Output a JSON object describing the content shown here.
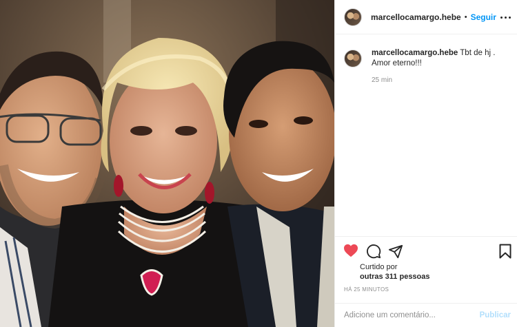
{
  "post": {
    "username": "marcellocamargo.hebe",
    "follow_label": "Seguir",
    "separator": "•",
    "caption_text": " Tbt de hj .",
    "caption_line2": "Amor eterno!!!",
    "caption_time": "25 min",
    "liked_by_label": "Curtido por",
    "liked_by_others": "outras 311 pessoas",
    "posted_ago": "HÁ 25 MINUTOS",
    "comment_placeholder": "Adicione um comentário...",
    "publish_label": "Publicar"
  },
  "icons": {
    "options": "more-icon",
    "like": "heart-icon",
    "comment": "comment-icon",
    "share": "send-icon",
    "save": "bookmark-icon"
  },
  "colors": {
    "accent": "#0095f6",
    "heart": "#ed4956",
    "publish_disabled": "#b2dffc",
    "muted": "#8e8e8e"
  }
}
